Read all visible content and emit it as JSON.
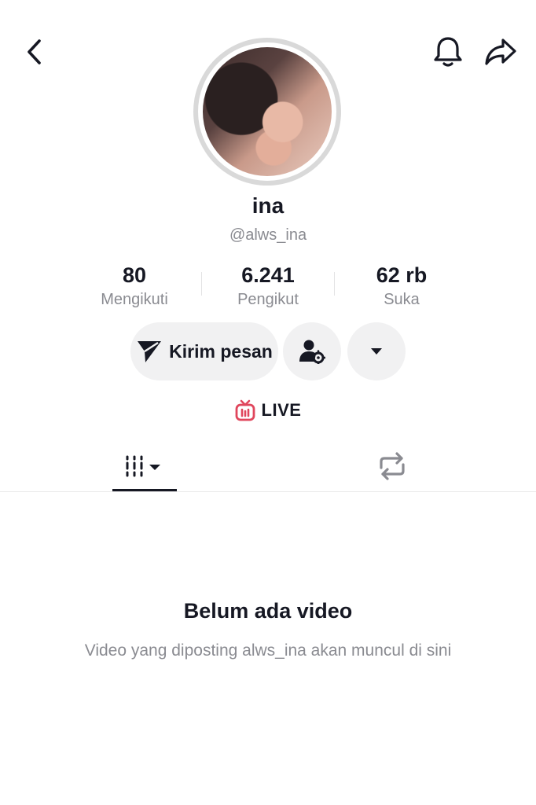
{
  "profile": {
    "username": "ina",
    "handle": "@alws_ina"
  },
  "stats": [
    {
      "value": "80",
      "label": "Mengikuti"
    },
    {
      "value": "6.241",
      "label": "Pengikut"
    },
    {
      "value": "62 rb",
      "label": "Suka"
    }
  ],
  "actions": {
    "message_label": "Kirim pesan"
  },
  "live": {
    "label": "LIVE"
  },
  "empty_state": {
    "title": "Belum ada video",
    "subtitle": "Video yang diposting alws_ina akan muncul di sini"
  },
  "colors": {
    "live_icon": "#e0465c",
    "text_primary": "#161823",
    "text_secondary": "#8a8b91",
    "button_bg": "#f1f1f2"
  },
  "icons": {
    "back": "chevron-left-icon",
    "bell": "bell-icon",
    "share": "share-arrow-icon",
    "send": "paper-plane-icon",
    "friend_settings": "user-gear-icon",
    "dropdown": "caret-down-icon",
    "live": "tv-icon",
    "videos_tab": "grid-bars-icon",
    "reposts_tab": "repost-icon"
  }
}
